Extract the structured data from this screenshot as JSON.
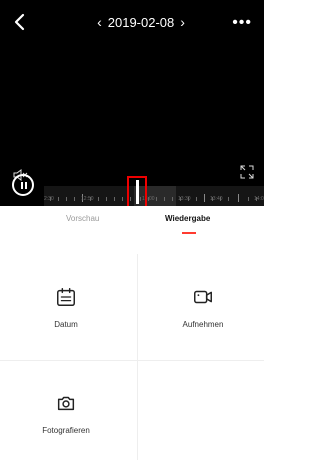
{
  "header": {
    "date": "2019-02-08",
    "prev_glyph": "‹",
    "next_glyph": "›",
    "more_glyph": "•••"
  },
  "timeline": {
    "labels": [
      "2:30",
      "12:50",
      "13:00",
      "13:30",
      "13:40",
      "14:0"
    ]
  },
  "tabs": [
    {
      "label": "Vorschau",
      "active": false
    },
    {
      "label": "Wiedergabe",
      "active": true
    }
  ],
  "actions": {
    "datum": "Datum",
    "record": "Aufnehmen",
    "photo": "Fotografieren"
  },
  "colors": {
    "accent": "#ff3b30",
    "highlight_box": "#ee0000"
  },
  "icons": {
    "back": "back-chevron-icon",
    "mute": "mute-icon",
    "fullscreen": "fullscreen-icon",
    "pause": "pause-icon",
    "calendar": "calendar-icon",
    "video": "video-camera-icon",
    "camera": "camera-icon"
  }
}
